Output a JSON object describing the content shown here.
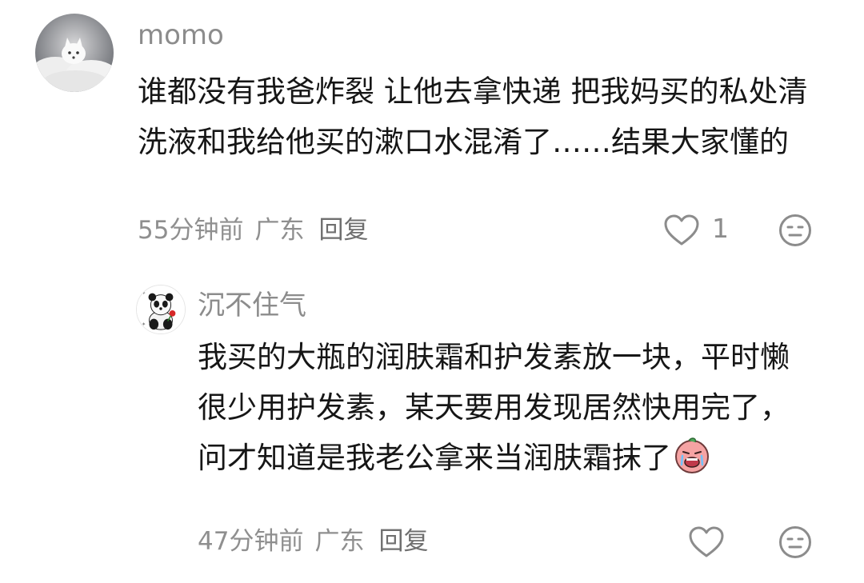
{
  "comments": [
    {
      "username": "momo",
      "text": "谁都没有我爸炸裂 让他去拿快递 把我妈买的私处清洗液和我给他买的漱口水混淆了……结果大家懂的",
      "time": "55分钟前",
      "location": "广东",
      "reply_label": "回复",
      "like_count": "1",
      "like_icon": "heart-outline-icon",
      "react_icon": "neutral-face-icon",
      "avatar": "white-fox-on-clouds"
    },
    {
      "username": "沉不住气",
      "text": "我买的大瓶的润肤霜和护发素放一块，平时懒很少用护发素，某天要用发现居然快用完了，问才知道是我老公拿来当润肤霜抹了",
      "inline_emoji": "crying-face-sticker",
      "time": "47分钟前",
      "location": "广东",
      "reply_label": "回复",
      "like_count": "",
      "like_icon": "heart-outline-icon",
      "react_icon": "neutral-face-icon",
      "avatar": "panda-with-rose"
    }
  ],
  "colors": {
    "text_primary": "#161616",
    "text_secondary": "#8c8c8c",
    "background": "#ffffff"
  }
}
